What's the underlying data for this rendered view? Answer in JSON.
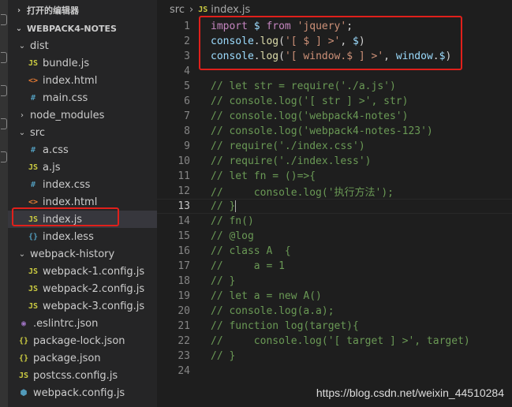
{
  "sidebar": {
    "section_title": "打开的编辑器",
    "project_title": "WEBPACK4-NOTES",
    "tree": [
      {
        "name": "dist",
        "kind": "folder",
        "icon": "chevron-down-icon",
        "depth": 1
      },
      {
        "name": "bundle.js",
        "kind": "js",
        "depth": 2
      },
      {
        "name": "index.html",
        "kind": "html",
        "depth": 2
      },
      {
        "name": "main.css",
        "kind": "css",
        "depth": 2
      },
      {
        "name": "node_modules",
        "kind": "folder-closed",
        "icon": "chevron-right-icon",
        "depth": 1
      },
      {
        "name": "src",
        "kind": "folder",
        "icon": "chevron-down-icon",
        "depth": 1
      },
      {
        "name": "a.css",
        "kind": "css",
        "depth": 2
      },
      {
        "name": "a.js",
        "kind": "js",
        "depth": 2
      },
      {
        "name": "index.css",
        "kind": "css",
        "depth": 2
      },
      {
        "name": "index.html",
        "kind": "html",
        "depth": 2
      },
      {
        "name": "index.js",
        "kind": "js",
        "depth": 2,
        "selected": true
      },
      {
        "name": "index.less",
        "kind": "less",
        "depth": 2
      },
      {
        "name": "webpack-history",
        "kind": "folder",
        "icon": "chevron-down-icon",
        "depth": 1
      },
      {
        "name": "webpack-1.config.js",
        "kind": "js",
        "depth": 2
      },
      {
        "name": "webpack-2.config.js",
        "kind": "js",
        "depth": 2
      },
      {
        "name": "webpack-3.config.js",
        "kind": "js",
        "depth": 2
      },
      {
        "name": ".eslintrc.json",
        "kind": "eslint",
        "depth": 1
      },
      {
        "name": "package-lock.json",
        "kind": "json",
        "depth": 1
      },
      {
        "name": "package.json",
        "kind": "json",
        "depth": 1
      },
      {
        "name": "postcss.config.js",
        "kind": "js",
        "depth": 1
      },
      {
        "name": "webpack.config.js",
        "kind": "webpack",
        "depth": 1
      }
    ],
    "icon_glyphs": {
      "js": "JS",
      "html": "<>",
      "css": "#",
      "less": "{}",
      "json": "{}",
      "eslint": "◉",
      "webpack": "⬢"
    }
  },
  "breadcrumb": {
    "folder": "src",
    "separator": "›",
    "file": "index.js",
    "file_icon": "JS"
  },
  "editor": {
    "current_line": 13,
    "lines": [
      {
        "n": "1",
        "tokens": [
          [
            "kw",
            "import"
          ],
          [
            "plain",
            " "
          ],
          [
            "var",
            "$"
          ],
          [
            "plain",
            " "
          ],
          [
            "kw",
            "from"
          ],
          [
            "plain",
            " "
          ],
          [
            "str",
            "'jquery'"
          ],
          [
            "plain",
            ";"
          ]
        ]
      },
      {
        "n": "2",
        "tokens": [
          [
            "var",
            "console"
          ],
          [
            "plain",
            "."
          ],
          [
            "fn",
            "log"
          ],
          [
            "plain",
            "("
          ],
          [
            "str",
            "'[ $ ] >'"
          ],
          [
            "plain",
            ", "
          ],
          [
            "var",
            "$"
          ],
          [
            "plain",
            ")"
          ]
        ]
      },
      {
        "n": "3",
        "tokens": [
          [
            "var",
            "console"
          ],
          [
            "plain",
            "."
          ],
          [
            "fn",
            "log"
          ],
          [
            "plain",
            "("
          ],
          [
            "str",
            "'[ window.$ ] >'"
          ],
          [
            "plain",
            ", "
          ],
          [
            "var",
            "window"
          ],
          [
            "plain",
            "."
          ],
          [
            "var",
            "$"
          ],
          [
            "plain",
            ")"
          ]
        ]
      },
      {
        "n": "4",
        "tokens": []
      },
      {
        "n": "5",
        "tokens": [
          [
            "cmt",
            "// let str = require('./a.js')"
          ]
        ]
      },
      {
        "n": "6",
        "tokens": [
          [
            "cmt",
            "// console.log('[ str ] >', str)"
          ]
        ]
      },
      {
        "n": "7",
        "tokens": [
          [
            "cmt",
            "// console.log('webpack4-notes')"
          ]
        ]
      },
      {
        "n": "8",
        "tokens": [
          [
            "cmt",
            "// console.log('webpack4-notes-123')"
          ]
        ]
      },
      {
        "n": "9",
        "tokens": [
          [
            "cmt",
            "// require('./index.css')"
          ]
        ]
      },
      {
        "n": "10",
        "tokens": [
          [
            "cmt",
            "// require('./index.less')"
          ]
        ]
      },
      {
        "n": "11",
        "tokens": [
          [
            "cmt",
            "// let fn = ()=>{"
          ]
        ]
      },
      {
        "n": "12",
        "tokens": [
          [
            "cmt",
            "//     console.log('执行方法');"
          ]
        ]
      },
      {
        "n": "13",
        "tokens": [
          [
            "cmt",
            "// }"
          ]
        ]
      },
      {
        "n": "14",
        "tokens": [
          [
            "cmt",
            "// fn()"
          ]
        ]
      },
      {
        "n": "15",
        "tokens": [
          [
            "cmt",
            "// @log"
          ]
        ]
      },
      {
        "n": "16",
        "tokens": [
          [
            "cmt",
            "// class A  {"
          ]
        ]
      },
      {
        "n": "17",
        "tokens": [
          [
            "cmt",
            "//     a = 1"
          ]
        ]
      },
      {
        "n": "18",
        "tokens": [
          [
            "cmt",
            "// }"
          ]
        ]
      },
      {
        "n": "19",
        "tokens": [
          [
            "cmt",
            "// let a = new A()"
          ]
        ]
      },
      {
        "n": "20",
        "tokens": [
          [
            "cmt",
            "// console.log(a.a);"
          ]
        ]
      },
      {
        "n": "21",
        "tokens": [
          [
            "cmt",
            "// function log(target){"
          ]
        ]
      },
      {
        "n": "22",
        "tokens": [
          [
            "cmt",
            "//     console.log('[ target ] >', target)"
          ]
        ]
      },
      {
        "n": "23",
        "tokens": [
          [
            "cmt",
            "// }"
          ]
        ]
      },
      {
        "n": "24",
        "tokens": []
      }
    ]
  },
  "watermark": "https://blog.csdn.net/weixin_44510284",
  "colors": {
    "annotation_red": "#e0201b",
    "selection": "#37373d",
    "comment": "#6a9955",
    "keyword": "#c586c0",
    "string": "#ce9178"
  }
}
